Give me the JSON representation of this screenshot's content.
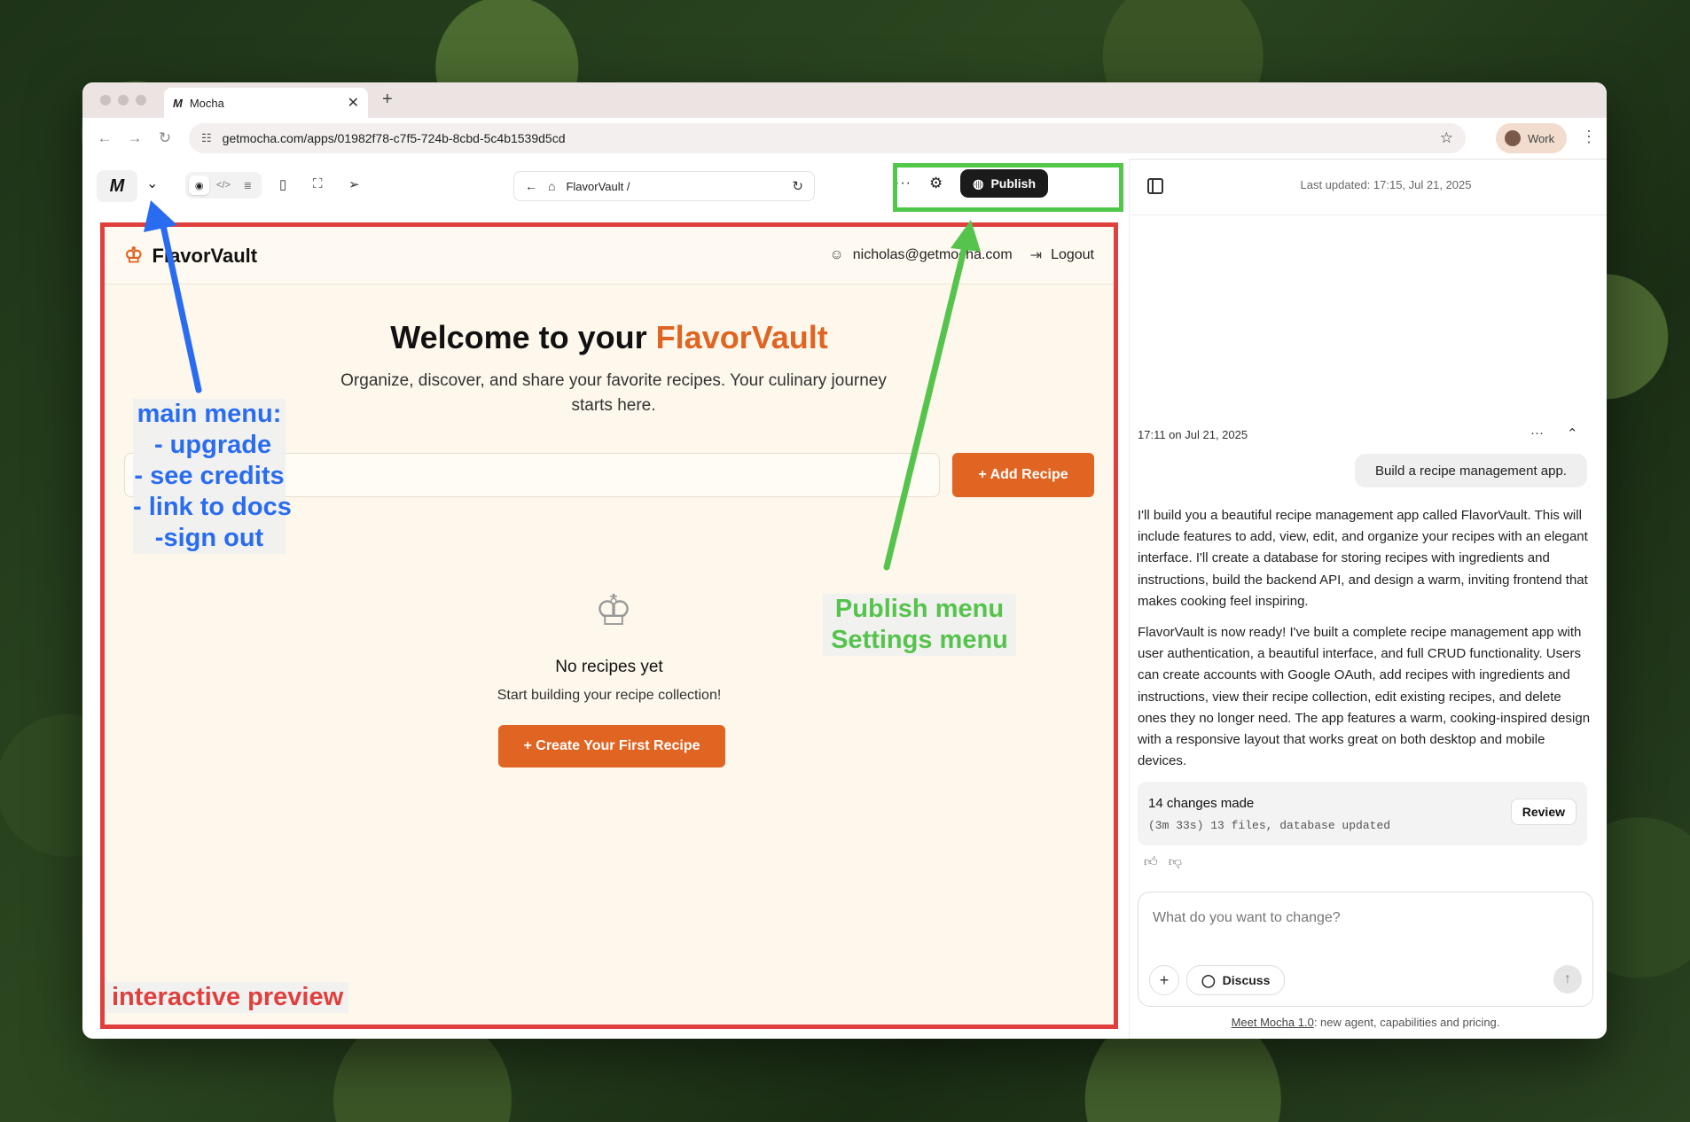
{
  "browser": {
    "tab_title": "Mocha",
    "tab_icon": "M",
    "url": "getmocha.com/apps/01982f78-c7f5-724b-8cbd-5c4b1539d5cd",
    "profile_label": "Work"
  },
  "toolbar": {
    "logo": "M",
    "preview_path": "FlavorVault /",
    "publish_label": "Publish",
    "more_label": "···"
  },
  "chat_header": {
    "last_updated": "Last updated: 17:15, Jul 21, 2025"
  },
  "preview": {
    "brand": "FlavorVault",
    "user_email": "nicholas@getmocha.com",
    "logout_label": "Logout",
    "title_prefix": "Welcome to your ",
    "title_accent": "FlavorVault",
    "subtitle": "Organize, discover, and share your favorite recipes. Your culinary journey starts here.",
    "add_recipe_label": "Add Recipe",
    "empty_title": "No recipes yet",
    "empty_subtitle": "Start building your recipe collection!",
    "create_first_label": "Create Your First Recipe"
  },
  "annotations": {
    "main_menu": "main menu:\n - upgrade\n- see credits\n- link to docs\n-sign out",
    "publish_menu": "Publish menu\nSettings menu",
    "preview_label": "interactive preview",
    "colors": {
      "blue": "#2a6cf0",
      "green": "#56c44c",
      "red": "#e0403d"
    }
  },
  "chat": {
    "timestamp": "17:11 on Jul 21, 2025",
    "user_message": "Build a recipe management app.",
    "reply_1": "I'll build you a beautiful recipe management app called FlavorVault. This will include features to add, view, edit, and organize your recipes with an elegant interface. I'll create a database for storing recipes with ingredients and instructions, build the backend API, and design a warm, inviting frontend that makes cooking feel inspiring.",
    "reply_2": "FlavorVault is now ready! I've built a complete recipe management app with user authentication, a beautiful interface, and full CRUD functionality. Users can create accounts with Google OAuth, add recipes with ingredients and instructions, view their recipe collection, edit existing recipes, and delete ones they no longer need. The app features a warm, cooking-inspired design with a responsive layout that works great on both desktop and mobile devices.",
    "changes_title": "14 changes made",
    "changes_meta": "(3m 33s) 13 files, database updated",
    "review_label": "Review",
    "input_placeholder": "What do you want to change?",
    "discuss_label": "Discuss",
    "footer_link": "Meet Mocha 1.0",
    "footer_rest": ": new agent, capabilities and pricing."
  },
  "accent_color": "#e06422"
}
